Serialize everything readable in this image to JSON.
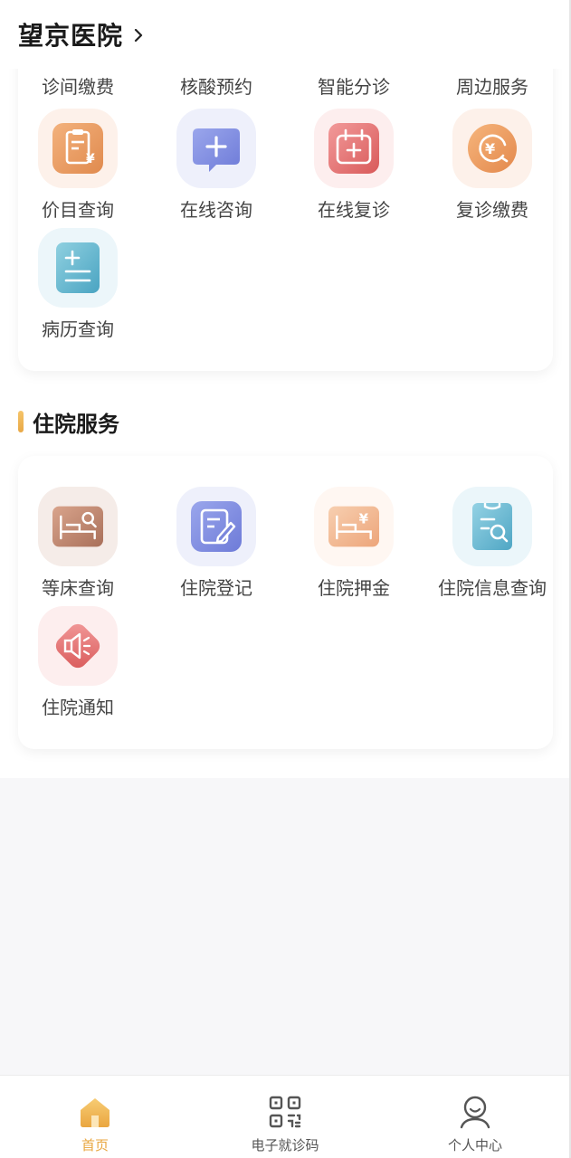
{
  "header": {
    "title": "望京医院",
    "chevron_icon": "chevron-right-icon"
  },
  "outpatient": {
    "items": [
      {
        "label": "诊间缴费"
      },
      {
        "label": "核酸预约"
      },
      {
        "label": "智能分诊"
      },
      {
        "label": "周边服务"
      },
      {
        "label": "价目查询",
        "icon": "price-list-icon",
        "color": "#e8955a"
      },
      {
        "label": "在线咨询",
        "icon": "chat-plus-icon",
        "color": "#7e8ce0"
      },
      {
        "label": "在线复诊",
        "icon": "calendar-plus-icon",
        "color": "#e06a6a"
      },
      {
        "label": "复诊缴费",
        "icon": "yuan-refresh-icon",
        "color": "#ec9a5e"
      },
      {
        "label": "病历查询",
        "icon": "medical-record-icon",
        "color": "#5ab3cc"
      }
    ]
  },
  "inpatient": {
    "title": "住院服务",
    "items": [
      {
        "label": "等床查询",
        "icon": "bed-search-icon",
        "color": "#b98068"
      },
      {
        "label": "住院登记",
        "icon": "register-edit-icon",
        "color": "#7a86dc"
      },
      {
        "label": "住院押金",
        "icon": "bed-yuan-icon",
        "color": "#f0b48a"
      },
      {
        "label": "住院信息查询",
        "icon": "clipboard-search-icon",
        "color": "#68b8d4"
      },
      {
        "label": "住院通知",
        "icon": "speaker-icon",
        "color": "#e06a6a"
      }
    ]
  },
  "tabbar": {
    "tabs": [
      {
        "label": "首页",
        "icon": "home-icon",
        "active": true
      },
      {
        "label": "电子就诊码",
        "icon": "qr-code-icon",
        "active": false
      },
      {
        "label": "个人中心",
        "icon": "user-icon",
        "active": false
      }
    ],
    "active_color": "#e8a63f"
  }
}
